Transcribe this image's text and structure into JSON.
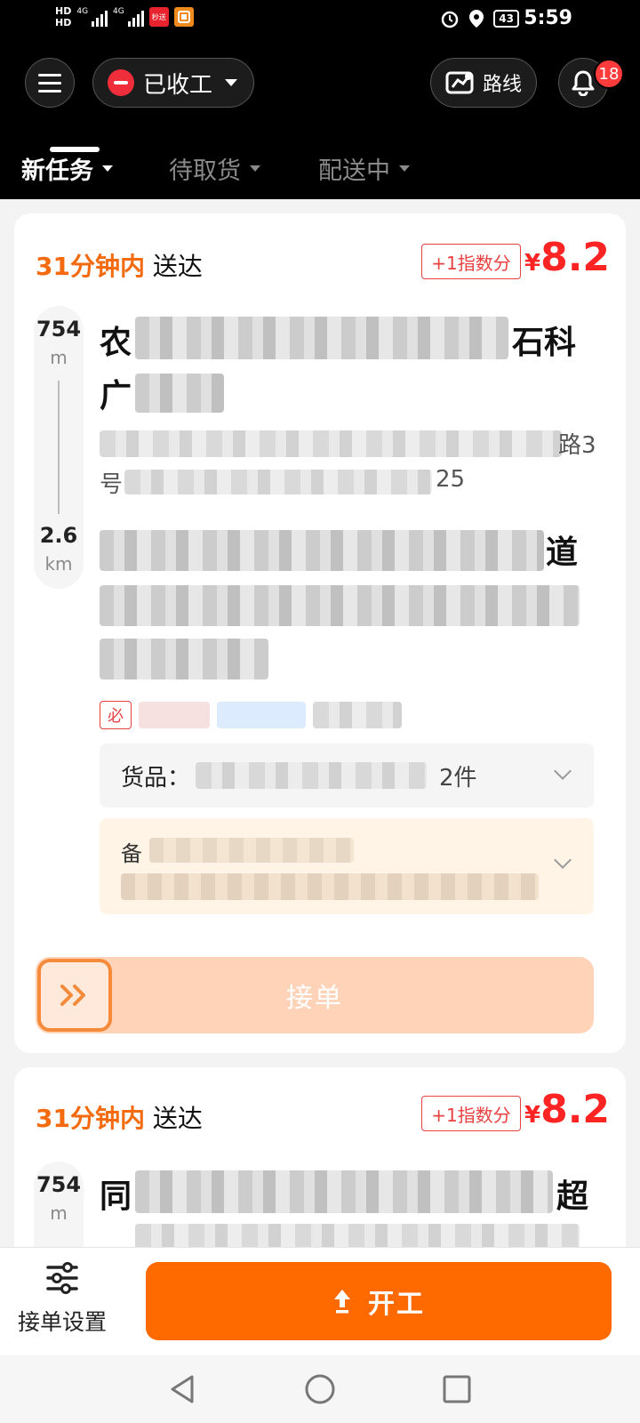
{
  "status_bar": {
    "hd1": "HD",
    "hd2": "HD",
    "net1": "4G",
    "net2": "4G",
    "battery": "43",
    "time": "5:59",
    "app1_text": "秒送"
  },
  "header": {
    "work_status": "已收工",
    "route_label": "路线",
    "notification_count": "18"
  },
  "tabs": [
    {
      "label": "新任务",
      "active": true
    },
    {
      "label": "待取货",
      "active": false
    },
    {
      "label": "配送中",
      "active": false
    }
  ],
  "orders": [
    {
      "eta_highlight": "31分钟内",
      "eta_suffix": "送达",
      "points": "+1指数分",
      "currency": "¥",
      "price": "8.2",
      "pickup_distance": "754",
      "pickup_unit": "m",
      "delivery_distance": "2.6",
      "delivery_unit": "km",
      "pickup_name_head": "农",
      "pickup_name_tail": "石科",
      "pickup_name_line2": "广",
      "pickup_addr_tail": "路3",
      "pickup_addr_line2_head": "号",
      "pickup_addr_line2_tail": "25",
      "delivery_addr_tail": "道",
      "tag_required": "必",
      "goods_label": "货品：",
      "goods_count": "2件",
      "note_label": "备",
      "accept_label": "接单"
    },
    {
      "eta_highlight": "31分钟内",
      "eta_suffix": "送达",
      "points": "+1指数分",
      "currency": "¥",
      "price": "8.2",
      "pickup_distance": "754",
      "pickup_unit": "m",
      "pickup_name_head": "同",
      "pickup_name_tail": "超"
    }
  ],
  "bottom": {
    "settings_label": "接单设置",
    "start_label": "开工"
  }
}
